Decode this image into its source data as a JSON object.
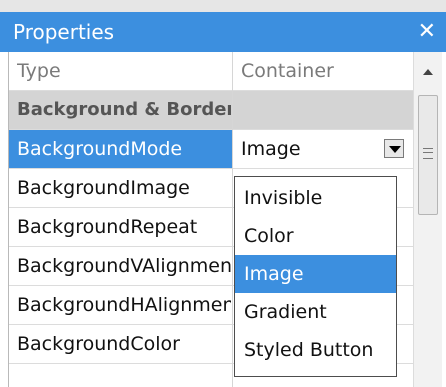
{
  "window": {
    "title": "Properties"
  },
  "grid": {
    "header": {
      "name": "Type",
      "value": "Container"
    },
    "category": "Background & Border",
    "rows": [
      {
        "name": "BackgroundMode",
        "value": "Image",
        "selected": true
      },
      {
        "name": "BackgroundImage",
        "value": ""
      },
      {
        "name": "BackgroundRepeat",
        "value": ""
      },
      {
        "name": "BackgroundVAlignment",
        "value": ""
      },
      {
        "name": "BackgroundHAlignment",
        "value": ""
      },
      {
        "name": "BackgroundColor",
        "value": ""
      }
    ]
  },
  "dropdown": {
    "options": [
      "Invisible",
      "Color",
      "Image",
      "Gradient",
      "Styled Button"
    ],
    "highlighted": "Image"
  },
  "icons": {
    "close": "close-icon",
    "combo": "chevron-down-icon",
    "scroll_up": "scroll-up-arrow-icon"
  },
  "colors": {
    "accent": "#3c8fdf",
    "category_bg": "#d4d4d4"
  }
}
